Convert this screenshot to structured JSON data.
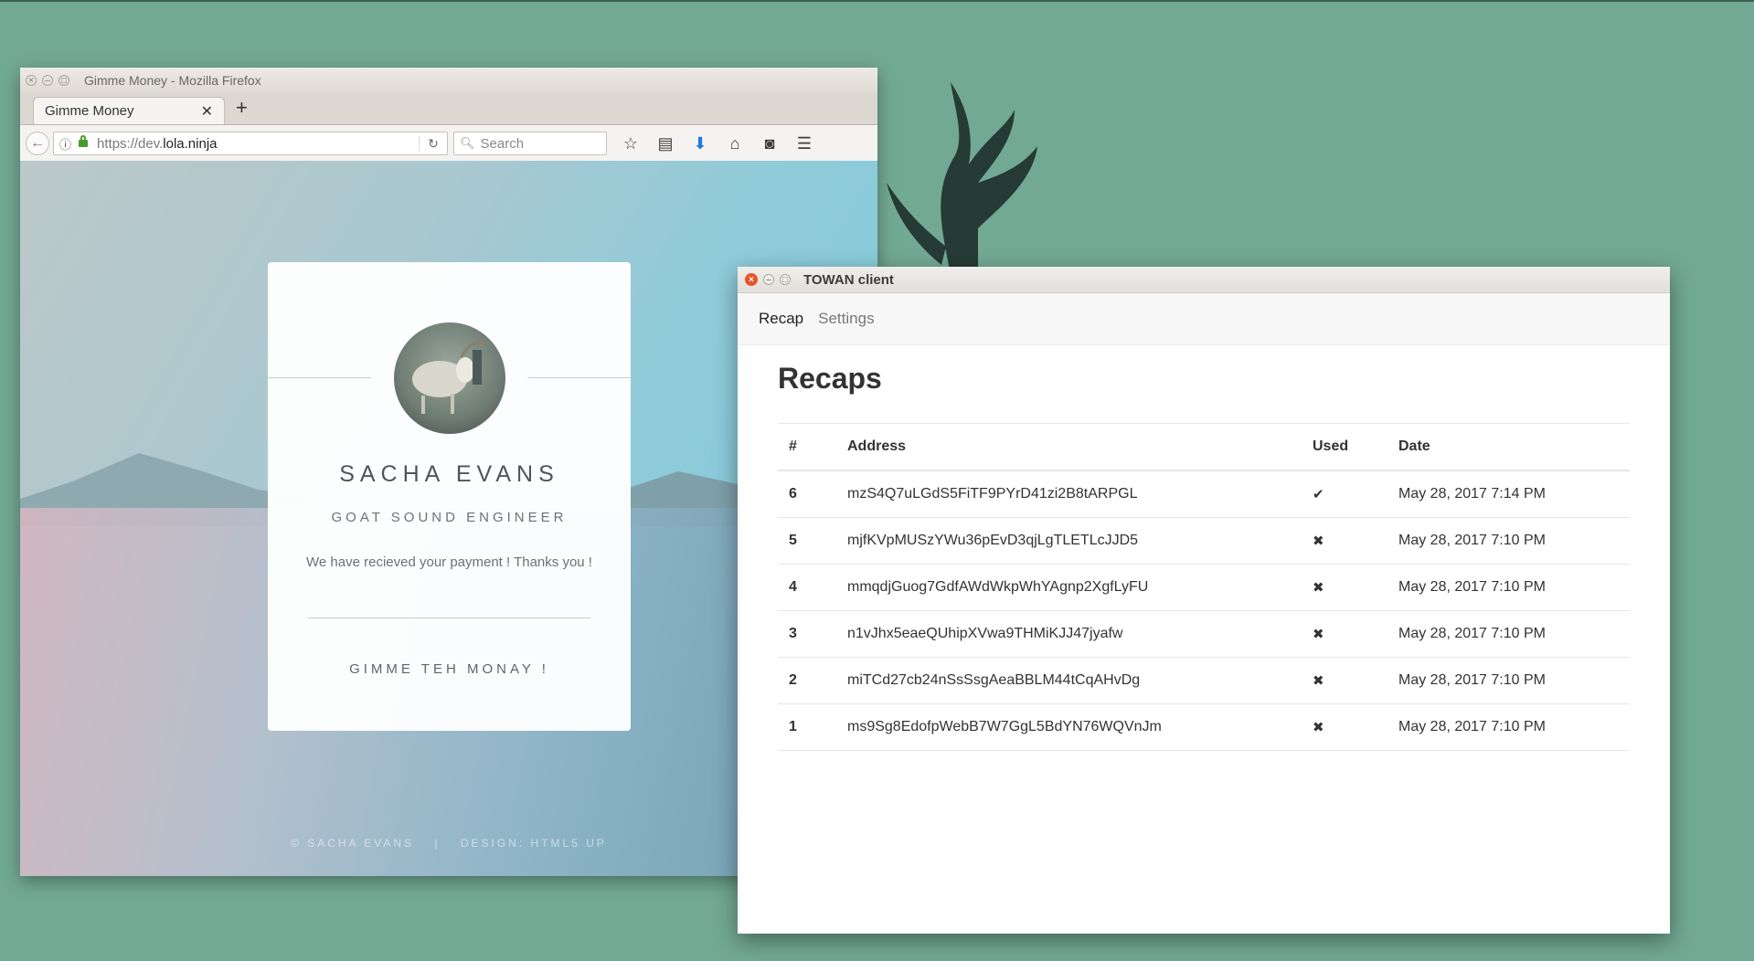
{
  "firefox": {
    "window_title": "Gimme Money - Mozilla Firefox",
    "tab_label": "Gimme Money",
    "url_prefix": "https://dev.",
    "url_domain": "lola.ninja",
    "search_placeholder": "Search"
  },
  "page": {
    "name": "SACHA EVANS",
    "role": "GOAT SOUND ENGINEER",
    "message": "We have recieved your payment ! Thanks you !",
    "cta": "GIMME TEH MONAY !",
    "footer_left": "© SACHA EVANS",
    "footer_sep": "|",
    "footer_right": "DESIGN: HTML5 UP"
  },
  "towan": {
    "window_title": "TOWAN client",
    "nav": [
      "Recap",
      "Settings"
    ],
    "heading": "Recaps",
    "columns": [
      "#",
      "Address",
      "Used",
      "Date"
    ],
    "rows": [
      {
        "num": "6",
        "address": "mzS4Q7uLGdS5FiTF9PYrD41zi2B8tARPGL",
        "used": "✔",
        "date": "May 28, 2017 7:14 PM"
      },
      {
        "num": "5",
        "address": "mjfKVpMUSzYWu36pEvD3qjLgTLETLcJJD5",
        "used": "✖",
        "date": "May 28, 2017 7:10 PM"
      },
      {
        "num": "4",
        "address": "mmqdjGuog7GdfAWdWkpWhYAgnp2XgfLyFU",
        "used": "✖",
        "date": "May 28, 2017 7:10 PM"
      },
      {
        "num": "3",
        "address": "n1vJhx5eaeQUhipXVwa9THMiKJJ47jyafw",
        "used": "✖",
        "date": "May 28, 2017 7:10 PM"
      },
      {
        "num": "2",
        "address": "miTCd27cb24nSsSsgAeaBBLM44tCqAHvDg",
        "used": "✖",
        "date": "May 28, 2017 7:10 PM"
      },
      {
        "num": "1",
        "address": "ms9Sg8EdofpWebB7W7GgL5BdYN76WQVnJm",
        "used": "✖",
        "date": "May 28, 2017 7:10 PM"
      }
    ]
  }
}
